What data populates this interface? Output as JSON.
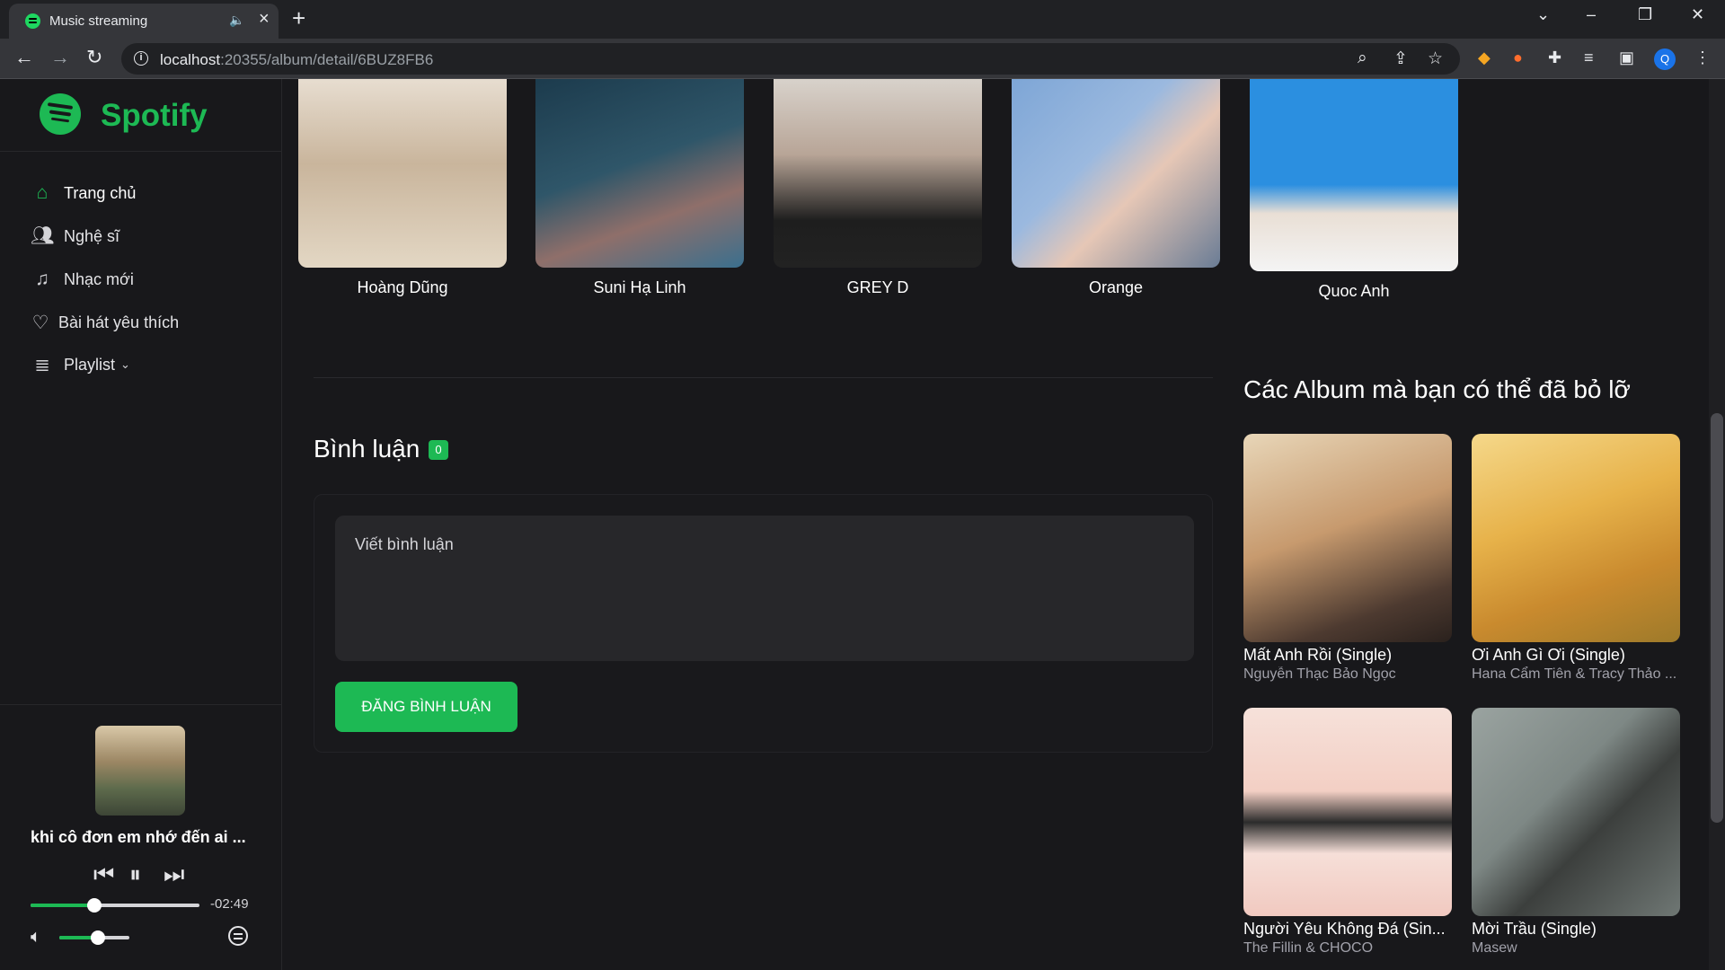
{
  "browser": {
    "tab_title": "Music streaming",
    "url_host": "localhost",
    "url_path": ":20355/album/detail/6BUZ8FB6"
  },
  "sidebar": {
    "logo_text": "Spotify",
    "items": [
      {
        "label": "Trang chủ",
        "icon": "home-icon"
      },
      {
        "label": "Nghệ sĩ",
        "icon": "artists-icon"
      },
      {
        "label": "Nhạc mới",
        "icon": "music-note-icon"
      },
      {
        "label": "Bài hát yêu thích",
        "icon": "heart-icon"
      },
      {
        "label": "Playlist",
        "icon": "playlist-icon"
      }
    ]
  },
  "player": {
    "title": "khi cô đơn em nhớ đến ai ...",
    "time_left": "-02:49",
    "progress": 0.38,
    "volume": 0.55
  },
  "artists": [
    {
      "name": "Hoàng Dũng"
    },
    {
      "name": "Suni Hạ Linh"
    },
    {
      "name": "GREY D"
    },
    {
      "name": "Orange"
    },
    {
      "name": "Quoc Anh"
    }
  ],
  "comments": {
    "title": "Bình luận",
    "count": "0",
    "placeholder": "Viết bình luận",
    "submit_label": "ĐĂNG BÌNH LUẬN"
  },
  "suggestions": {
    "title": "Các Album mà bạn có thể đã bỏ lỡ",
    "albums": [
      {
        "name": "Mất Anh Rồi (Single)",
        "artist": "Nguyễn Thạc Bảo Ngọc"
      },
      {
        "name": "Ơi Anh Gì Ơi (Single)",
        "artist": "Hana Cẩm Tiên & Tracy Thảo ..."
      },
      {
        "name": "Người Yêu Không Đá (Sin...",
        "artist": "The Fillin & CHOCO"
      },
      {
        "name": "Mời Trầu (Single)",
        "artist": "Masew"
      }
    ]
  },
  "colors": {
    "accent": "#1db954",
    "background": "#18181b",
    "input": "#27272a"
  }
}
